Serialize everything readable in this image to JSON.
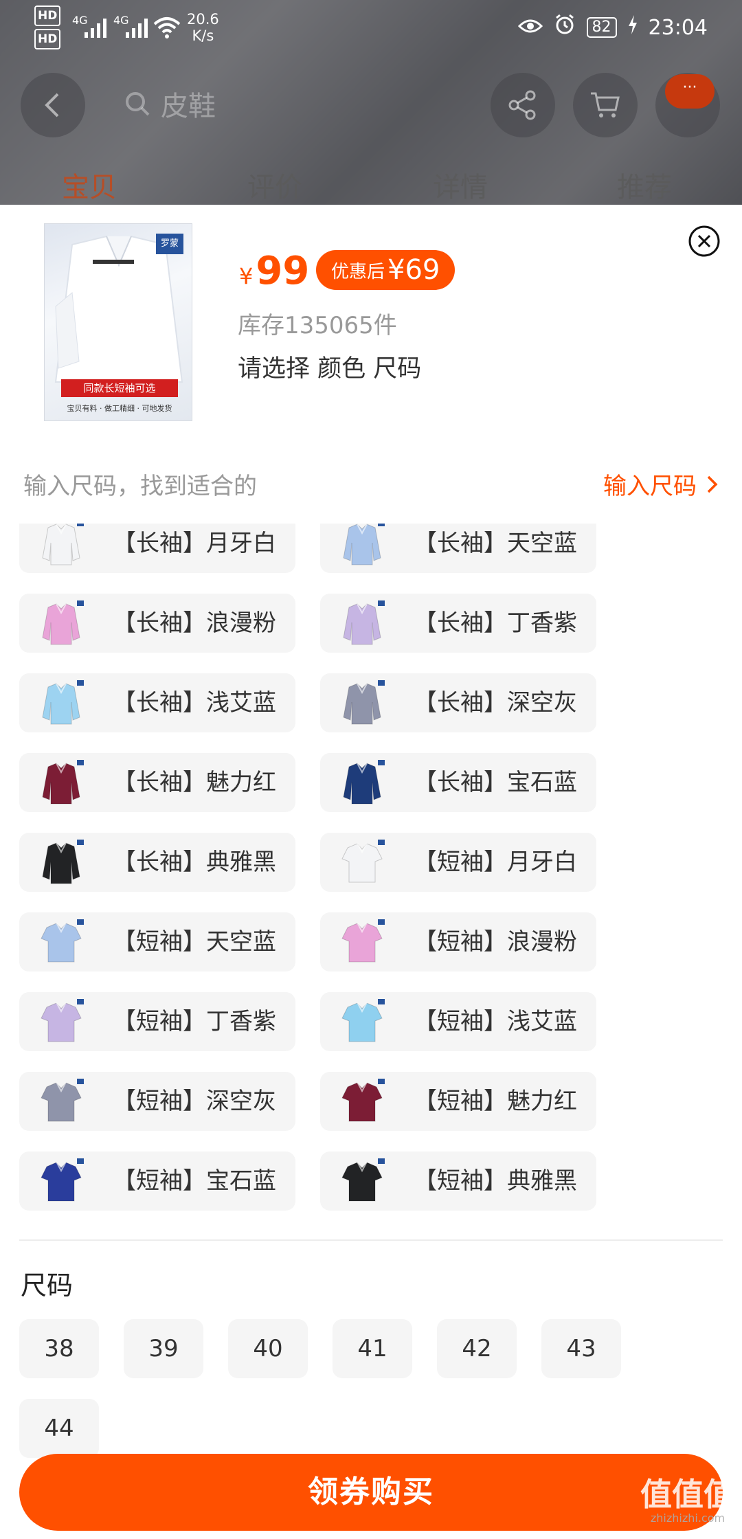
{
  "status_bar": {
    "hd1": "HD",
    "hd2": "HD",
    "sig1_label": "4G",
    "sig2_label": "4G",
    "net_speed_value": "20.6",
    "net_speed_unit": "K/s",
    "battery": "82",
    "time": "23:04"
  },
  "bg_page": {
    "search_text": "皮鞋",
    "tabs": [
      "宝贝",
      "评价",
      "详情",
      "推荐"
    ],
    "more_badge": "···"
  },
  "product": {
    "logo_text": "罗蒙",
    "image_banner": "同款长短袖可选",
    "image_subtext": "宝贝有料 · 做工精细 · 可地发货",
    "price_currency": "¥",
    "price": "99",
    "coupon_label": "优惠后",
    "coupon_price": "¥69",
    "stock": "库存135065件",
    "select_hint": "请选择 颜色 尺码"
  },
  "size_input": {
    "hint": "输入尺码，找到适合的",
    "link": "输入尺码"
  },
  "colors": [
    {
      "label": "【长袖】月牙白",
      "shirt": "#f3f4f6"
    },
    {
      "label": "【长袖】天空蓝",
      "shirt": "#a9c4ea"
    },
    {
      "label": "【长袖】浪漫粉",
      "shirt": "#e9a4d8"
    },
    {
      "label": "【长袖】丁香紫",
      "shirt": "#c6b5e3"
    },
    {
      "label": "【长袖】浅艾蓝",
      "shirt": "#9dd3f1"
    },
    {
      "label": "【长袖】深空灰",
      "shirt": "#8f94aa"
    },
    {
      "label": "【长袖】魅力红",
      "shirt": "#7c1d35"
    },
    {
      "label": "【长袖】宝石蓝",
      "shirt": "#1e3c7a"
    },
    {
      "label": "【长袖】典雅黑",
      "shirt": "#222325"
    },
    {
      "label": "【短袖】月牙白",
      "shirt": "#f3f4f6"
    },
    {
      "label": "【短袖】天空蓝",
      "shirt": "#a9c4ea"
    },
    {
      "label": "【短袖】浪漫粉",
      "shirt": "#e9a4d8"
    },
    {
      "label": "【短袖】丁香紫",
      "shirt": "#c6b5e3"
    },
    {
      "label": "【短袖】浅艾蓝",
      "shirt": "#8fd0ef"
    },
    {
      "label": "【短袖】深空灰",
      "shirt": "#8f94aa"
    },
    {
      "label": "【短袖】魅力红",
      "shirt": "#7c1d35"
    },
    {
      "label": "【短袖】宝石蓝",
      "shirt": "#2a3d9c"
    },
    {
      "label": "【短袖】典雅黑",
      "shirt": "#222325"
    }
  ],
  "size_section": {
    "title": "尺码",
    "sizes": [
      "38",
      "39",
      "40",
      "41",
      "42",
      "43",
      "44"
    ]
  },
  "buy_button": "领券购买",
  "watermark": {
    "big": "值值值",
    "small": "zhizhizhi.com"
  },
  "colors_theme": {
    "accent": "#ff5000",
    "chip_bg": "#f5f5f5"
  }
}
